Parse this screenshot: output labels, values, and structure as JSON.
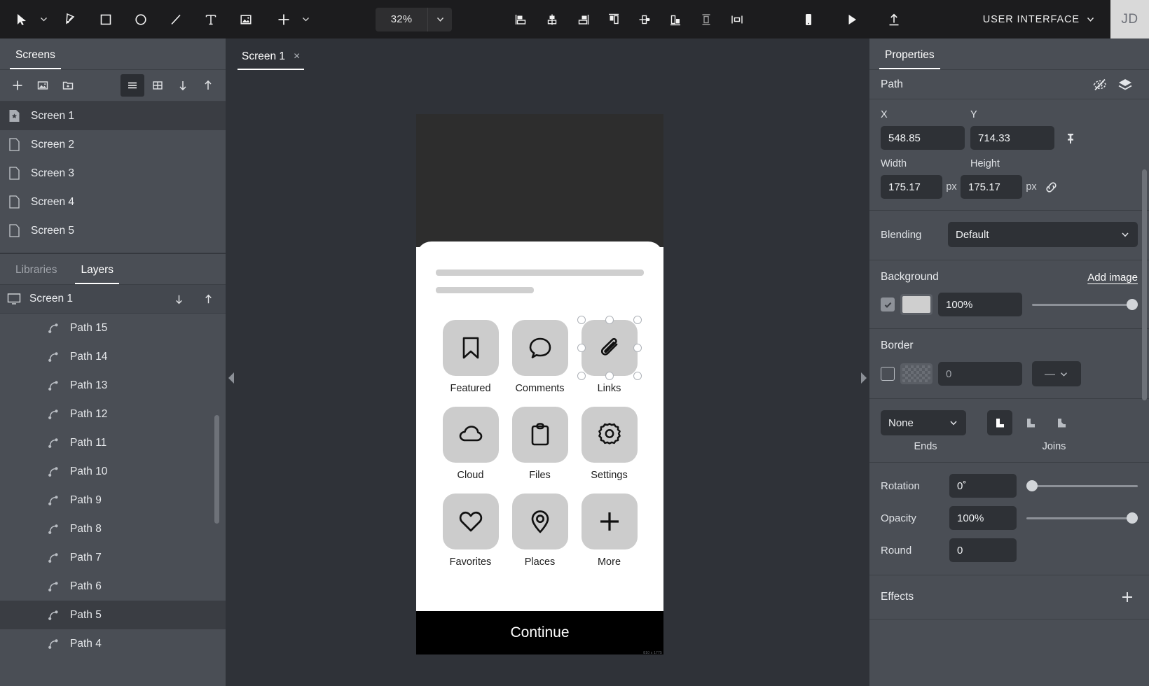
{
  "toolbar": {
    "tools": [
      {
        "name": "select-tool",
        "icon": "cursor-arrow-icon",
        "has_caret": true
      },
      {
        "name": "pen-tool",
        "icon": "pen-nib-icon",
        "has_caret": false
      },
      {
        "name": "rectangle-tool",
        "icon": "square-icon",
        "has_caret": false
      },
      {
        "name": "ellipse-tool",
        "icon": "circle-icon",
        "has_caret": false
      },
      {
        "name": "line-tool",
        "icon": "line-icon",
        "has_caret": false
      },
      {
        "name": "text-tool",
        "icon": "text-t-icon",
        "has_caret": false
      },
      {
        "name": "image-tool",
        "icon": "image-icon",
        "has_caret": false
      },
      {
        "name": "add-tool",
        "icon": "plus-icon",
        "has_caret": true
      }
    ],
    "zoom_value": "32%",
    "align_buttons": [
      "align-left-icon",
      "align-center-horizontal-icon",
      "align-right-icon",
      "align-top-icon",
      "align-center-vertical-icon",
      "align-bottom-icon",
      "distribute-vertical-icon",
      "distribute-horizontal-icon"
    ],
    "preview_buttons": [
      "mobile-preview-icon",
      "play-icon",
      "export-upload-icon"
    ],
    "project_name": "USER INTERFACE",
    "avatar_initials": "JD"
  },
  "left_panel": {
    "tab_label": "Screens",
    "actions": [
      {
        "name": "add-screen-button",
        "icon": "plus-icon"
      },
      {
        "name": "add-image-button",
        "icon": "image-icon"
      },
      {
        "name": "add-folder-button",
        "icon": "folder-plus-icon"
      },
      {
        "name": "list-view-button",
        "icon": "list-view-icon",
        "active": true
      },
      {
        "name": "grid-view-button",
        "icon": "grid-view-icon",
        "active": false
      },
      {
        "name": "sort-down-button",
        "icon": "arrow-down-icon"
      },
      {
        "name": "sort-up-button",
        "icon": "arrow-up-icon"
      }
    ],
    "screens": [
      {
        "label": "Screen 1",
        "active": true,
        "icon": "home-screen-icon"
      },
      {
        "label": "Screen 2",
        "active": false,
        "icon": "page-icon"
      },
      {
        "label": "Screen 3",
        "active": false,
        "icon": "page-icon"
      },
      {
        "label": "Screen 4",
        "active": false,
        "icon": "page-icon"
      },
      {
        "label": "Screen 5",
        "active": false,
        "icon": "page-icon"
      }
    ],
    "layers_tabs": [
      {
        "label": "Libraries",
        "active": false
      },
      {
        "label": "Layers",
        "active": true
      }
    ],
    "layers_root": "Screen 1",
    "layers": [
      {
        "label": "Path 15",
        "active": false
      },
      {
        "label": "Path 14",
        "active": false
      },
      {
        "label": "Path 13",
        "active": false
      },
      {
        "label": "Path 12",
        "active": false
      },
      {
        "label": "Path 11",
        "active": false
      },
      {
        "label": "Path 10",
        "active": false
      },
      {
        "label": "Path 9",
        "active": false
      },
      {
        "label": "Path 8",
        "active": false
      },
      {
        "label": "Path 7",
        "active": false
      },
      {
        "label": "Path 6",
        "active": false
      },
      {
        "label": "Path 5",
        "active": true
      },
      {
        "label": "Path 4",
        "active": false
      }
    ]
  },
  "canvas": {
    "tab_label": "Screen 1",
    "tab_close": "×",
    "artboard_dims": "810 x 1775"
  },
  "mockup": {
    "grid": [
      {
        "label": "Featured",
        "icon": "bookmark-icon",
        "selected": false
      },
      {
        "label": "Comments",
        "icon": "speech-bubble-icon",
        "selected": false
      },
      {
        "label": "Links",
        "icon": "paperclip-icon",
        "selected": true
      },
      {
        "label": "Cloud",
        "icon": "cloud-icon",
        "selected": false
      },
      {
        "label": "Files",
        "icon": "clipboard-icon",
        "selected": false
      },
      {
        "label": "Settings",
        "icon": "gear-icon",
        "selected": false
      },
      {
        "label": "Favorites",
        "icon": "heart-icon",
        "selected": false
      },
      {
        "label": "Places",
        "icon": "map-pin-icon",
        "selected": false
      },
      {
        "label": "More",
        "icon": "plus-icon",
        "selected": false
      }
    ],
    "cta_label": "Continue"
  },
  "properties": {
    "tab_label": "Properties",
    "object_type": "Path",
    "header_icons": [
      {
        "name": "hide-visibility-icon"
      },
      {
        "name": "layers-stack-icon"
      }
    ],
    "x_label": "X",
    "x_value": "548.85",
    "y_label": "Y",
    "y_value": "714.33",
    "pin_icon": "pin-icon",
    "width_label": "Width",
    "width_value": "175.17",
    "width_unit": "px",
    "height_label": "Height",
    "height_value": "175.17",
    "height_unit": "px",
    "link_icon": "link-chain-icon",
    "blending_label": "Blending",
    "blending_value": "Default",
    "background_label": "Background",
    "add_image_label": "Add image",
    "background_enabled": true,
    "background_color": "#cfcfcf",
    "background_opacity": "100%",
    "border_label": "Border",
    "border_enabled": false,
    "border_width": "0",
    "border_style": "—",
    "ends_value": "None",
    "ends_label": "Ends",
    "joins_label": "Joins",
    "join_options": [
      "miter-join-icon",
      "round-join-icon",
      "bevel-join-icon"
    ],
    "rotation_label": "Rotation",
    "rotation_value": "0˚",
    "opacity_label": "Opacity",
    "opacity_value": "100%",
    "round_label": "Round",
    "round_value": "0",
    "effects_label": "Effects",
    "effects_add_icon": "plus-icon"
  }
}
